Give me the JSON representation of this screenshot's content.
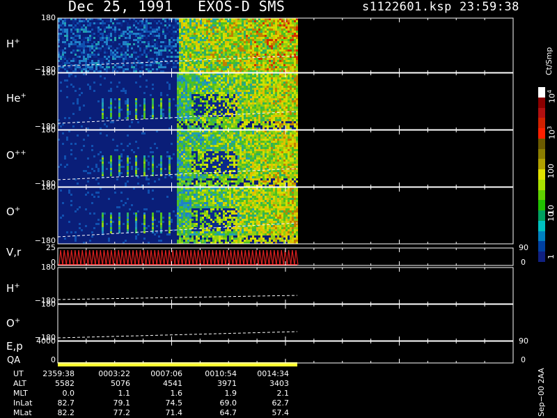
{
  "header": {
    "date": "Dec 25, 1991",
    "mission": "EXOS-D SMS",
    "file": "s1122601.ksp",
    "time": "23:59:38"
  },
  "panels": [
    {
      "id": "h-plus",
      "label": "H",
      "sup": "+",
      "ytop": "180",
      "ybot": "−180"
    },
    {
      "id": "he-plus",
      "label": "He",
      "sup": "+",
      "ytop": "180",
      "ybot": "−180"
    },
    {
      "id": "o-plusplus",
      "label": "O",
      "sup": "++",
      "ytop": "180",
      "ybot": "−180"
    },
    {
      "id": "o-plus",
      "label": "O",
      "sup": "+",
      "ytop": "180",
      "ybot": "−180"
    },
    {
      "id": "vr",
      "label": "V,r",
      "sup": "",
      "ytop": "25",
      "ybot": "0",
      "rtop": "90",
      "rbot": "0"
    },
    {
      "id": "h-plus-2",
      "label": "H",
      "sup": "+",
      "ytop": "180",
      "ybot": "−180"
    },
    {
      "id": "o-plus-2",
      "label": "O",
      "sup": "+",
      "ytop": "180",
      "ybot": "−180"
    },
    {
      "id": "ep",
      "label": "E,p",
      "sup": "",
      "ytop": "4000",
      "ybot": "0",
      "rtop": "90",
      "rbot": "0"
    }
  ],
  "qa_label": "QA",
  "colorbar": {
    "unit_label": "Ct/Smp",
    "ticks": [
      "10",
      "10",
      "100",
      "10",
      "10",
      "1"
    ],
    "tick_exps": [
      "4",
      "3",
      "",
      "",
      "",
      ""
    ],
    "colors": [
      "#ffffff",
      "#8b0000",
      "#b01010",
      "#d02000",
      "#ff2000",
      "#6b5a00",
      "#8b7d00",
      "#b0a000",
      "#e0e000",
      "#a8e000",
      "#60d000",
      "#20c000",
      "#00a060",
      "#00c0c0",
      "#0080c0",
      "#0040a0",
      "#102080"
    ]
  },
  "footer_stamp": "Sep−00  2AA",
  "orbit_table": {
    "row_names": [
      "UT",
      "ALT",
      "MLT",
      "InLat",
      "MLat"
    ],
    "columns": [
      [
        "2359:38",
        "5582",
        "0.0",
        "82.7",
        "82.2"
      ],
      [
        "0003:22",
        "5076",
        "1.1",
        "79.1",
        "77.2"
      ],
      [
        "0007:06",
        "4541",
        "1.6",
        "74.5",
        "71.4"
      ],
      [
        "0010:54",
        "3971",
        "1.9",
        "69.0",
        "64.7"
      ],
      [
        "0014:34",
        "3403",
        "2.1",
        "62.7",
        "57.4"
      ]
    ]
  },
  "chart_data": {
    "type": "heatmap",
    "title": "Dec 25, 1991   EXOS-D SMS",
    "x_times": [
      "2359:38",
      "0003:22",
      "0007:06",
      "0010:54",
      "0014:34"
    ],
    "data_end_fraction": 0.5,
    "colorbar_range": [
      1,
      10000
    ],
    "colorbar_scale": "log",
    "panels": [
      "H+",
      "He+",
      "O++",
      "O+",
      "V,r",
      "H+",
      "O+",
      "E,p"
    ]
  }
}
